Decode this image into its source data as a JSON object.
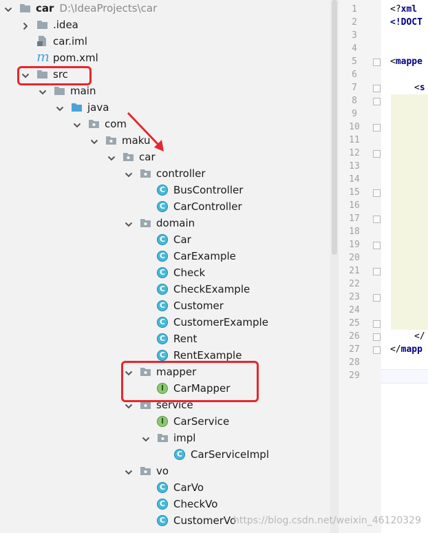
{
  "project": {
    "name": "car",
    "path": "D:\\IdeaProjects\\car"
  },
  "tree": [
    {
      "label": "car",
      "level": 0,
      "icon": "module-folder-icon",
      "arrow": "down",
      "bold": true,
      "sub": "D:\\IdeaProjects\\car"
    },
    {
      "label": ".idea",
      "level": 1,
      "icon": "folder-icon",
      "arrow": "right"
    },
    {
      "label": "car.iml",
      "level": 1,
      "icon": "iml-file-icon",
      "arrow": "none"
    },
    {
      "label": "pom.xml",
      "level": 1,
      "icon": "maven-icon",
      "arrow": "none"
    },
    {
      "label": "src",
      "level": 1,
      "icon": "folder-icon",
      "arrow": "down"
    },
    {
      "label": "main",
      "level": 2,
      "icon": "folder-icon",
      "arrow": "down"
    },
    {
      "label": "java",
      "level": 3,
      "icon": "source-folder-icon",
      "arrow": "down"
    },
    {
      "label": "com",
      "level": 4,
      "icon": "package-icon",
      "arrow": "down"
    },
    {
      "label": "maku",
      "level": 5,
      "icon": "package-icon",
      "arrow": "down"
    },
    {
      "label": "car",
      "level": 6,
      "icon": "package-icon",
      "arrow": "down"
    },
    {
      "label": "controller",
      "level": 7,
      "icon": "package-icon",
      "arrow": "down"
    },
    {
      "label": "BusController",
      "level": 8,
      "icon": "class-icon",
      "arrow": "none"
    },
    {
      "label": "CarController",
      "level": 8,
      "icon": "class-icon",
      "arrow": "none"
    },
    {
      "label": "domain",
      "level": 7,
      "icon": "package-icon",
      "arrow": "down"
    },
    {
      "label": "Car",
      "level": 8,
      "icon": "class-icon",
      "arrow": "none"
    },
    {
      "label": "CarExample",
      "level": 8,
      "icon": "class-icon",
      "arrow": "none"
    },
    {
      "label": "Check",
      "level": 8,
      "icon": "class-icon",
      "arrow": "none"
    },
    {
      "label": "CheckExample",
      "level": 8,
      "icon": "class-icon",
      "arrow": "none"
    },
    {
      "label": "Customer",
      "level": 8,
      "icon": "class-icon",
      "arrow": "none"
    },
    {
      "label": "CustomerExample",
      "level": 8,
      "icon": "class-icon",
      "arrow": "none"
    },
    {
      "label": "Rent",
      "level": 8,
      "icon": "class-icon",
      "arrow": "none"
    },
    {
      "label": "RentExample",
      "level": 8,
      "icon": "class-icon",
      "arrow": "none"
    },
    {
      "label": "mapper",
      "level": 7,
      "icon": "package-icon",
      "arrow": "down"
    },
    {
      "label": "CarMapper",
      "level": 8,
      "icon": "interface-icon",
      "arrow": "none"
    },
    {
      "label": "service",
      "level": 7,
      "icon": "package-icon",
      "arrow": "down"
    },
    {
      "label": "CarService",
      "level": 8,
      "icon": "interface-icon",
      "arrow": "none"
    },
    {
      "label": "impl",
      "level": 8,
      "icon": "package-icon",
      "arrow": "down"
    },
    {
      "label": "CarServiceImpl",
      "level": 9,
      "icon": "class-icon",
      "arrow": "none"
    },
    {
      "label": "vo",
      "level": 7,
      "icon": "package-icon",
      "arrow": "down"
    },
    {
      "label": "CarVo",
      "level": 8,
      "icon": "class-icon",
      "arrow": "none"
    },
    {
      "label": "CheckVo",
      "level": 8,
      "icon": "class-icon",
      "arrow": "none"
    },
    {
      "label": "CustomerVo",
      "level": 8,
      "icon": "class-icon",
      "arrow": "none"
    }
  ],
  "class_badge": "C",
  "interface_badge": "I",
  "maven_badge": "m",
  "line_numbers": [
    "1",
    "2",
    "3",
    "4",
    "5",
    "6",
    "7",
    "8",
    "9",
    "10",
    "11",
    "12",
    "13",
    "14",
    "15",
    "16",
    "17",
    "18",
    "19",
    "20",
    "21",
    "22",
    "23",
    "24",
    "25",
    "26",
    "27",
    "28",
    "29"
  ],
  "code_lines": [
    {
      "line": 1,
      "text": "<?xml"
    },
    {
      "line": 2,
      "text": "<!DOCT"
    },
    {
      "line": 5,
      "text": "<mappe"
    },
    {
      "line": 7,
      "text": "<s"
    },
    {
      "line": 26,
      "text": "</"
    },
    {
      "line": 27,
      "text": "</mapp"
    }
  ],
  "watermark": "https://blog.csdn.net/weixin_46120329",
  "colors": {
    "highlight": "#e8262b",
    "class_icon": "#46b8d9",
    "interface_icon": "#8bc872",
    "folder": "#9aa7b0",
    "source_folder": "#4aa3d8",
    "xml_tag": "#000080"
  }
}
